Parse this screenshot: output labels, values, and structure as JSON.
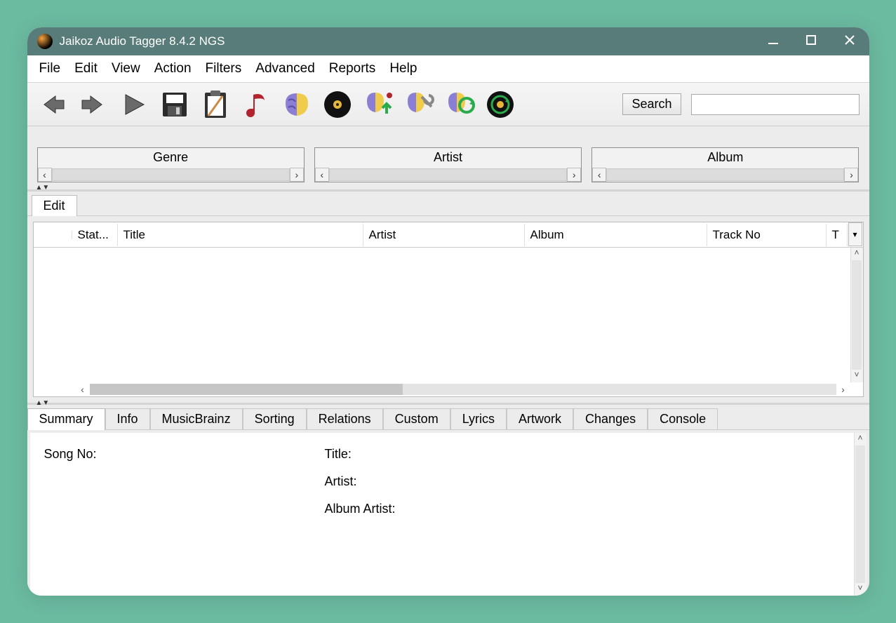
{
  "window": {
    "title": "Jaikoz Audio Tagger 8.4.2 NGS"
  },
  "menubar": [
    "File",
    "Edit",
    "View",
    "Action",
    "Filters",
    "Advanced",
    "Reports",
    "Help"
  ],
  "toolbar": {
    "search_label": "Search",
    "search_value": ""
  },
  "filters": [
    {
      "title": "Genre"
    },
    {
      "title": "Artist"
    },
    {
      "title": "Album"
    }
  ],
  "edit_tab": {
    "label": "Edit"
  },
  "table": {
    "columns": [
      "",
      "Stat...",
      "Title",
      "Artist",
      "Album",
      "Track No",
      "T"
    ]
  },
  "detail_tabs": [
    "Summary",
    "Info",
    "MusicBrainz",
    "Sorting",
    "Relations",
    "Custom",
    "Lyrics",
    "Artwork",
    "Changes",
    "Console"
  ],
  "details": {
    "song_no_label": "Song No:",
    "title_label": "Title:",
    "artist_label": "Artist:",
    "album_artist_label": "Album Artist:"
  }
}
